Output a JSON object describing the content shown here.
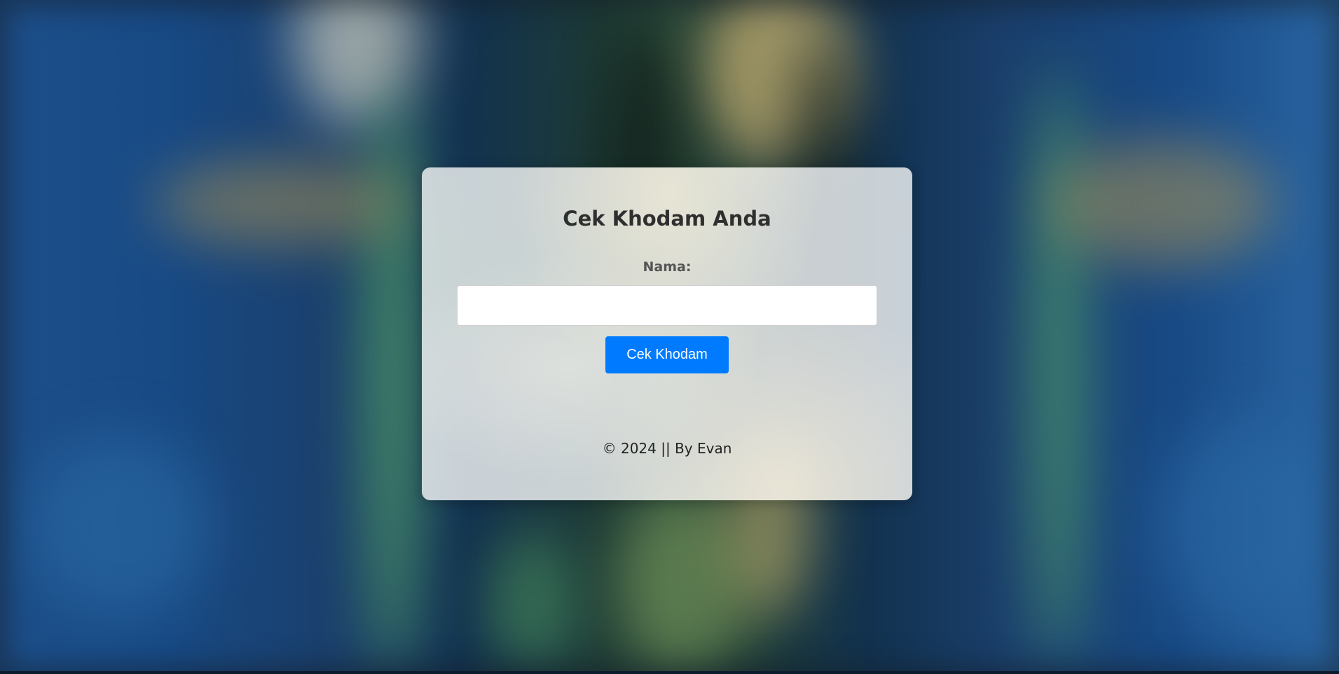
{
  "background": {
    "description_colors": [
      "#1d4f8a",
      "#12324f",
      "#2f6b4f",
      "#c9b373"
    ]
  },
  "card": {
    "title": "Cek Khodam Anda",
    "name_label": "Nama:",
    "name_input": {
      "value": "",
      "placeholder": ""
    },
    "submit_label": "Cek Khodam",
    "footer_text": "© 2024 || By Evan"
  },
  "colors": {
    "button": "#007bff",
    "button_text": "#ffffff",
    "title": "#2f2f2f"
  }
}
